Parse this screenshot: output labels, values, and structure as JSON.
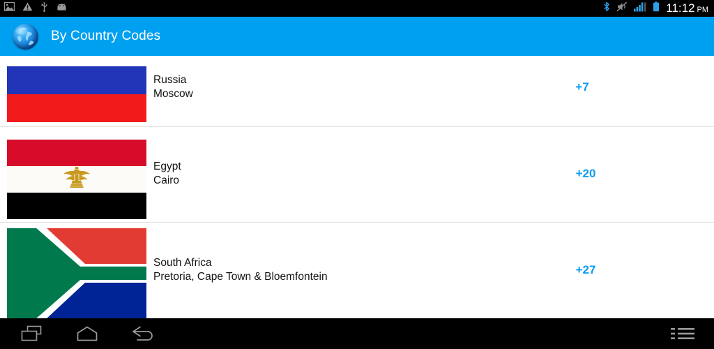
{
  "status_bar": {
    "left_icons": [
      {
        "name": "screenshot-icon",
        "label": "Screenshot"
      },
      {
        "name": "warning-icon",
        "label": "Warning"
      },
      {
        "name": "usb-icon",
        "label": "USB connected"
      },
      {
        "name": "android-icon",
        "label": "Android system"
      }
    ],
    "right_icons": [
      {
        "name": "bluetooth-icon",
        "label": "Bluetooth"
      },
      {
        "name": "mute-icon",
        "label": "Silent mode"
      },
      {
        "name": "signal-icon",
        "label": "Signal strength"
      },
      {
        "name": "battery-icon",
        "label": "Battery"
      }
    ],
    "time": "11:12",
    "am_pm": "PM"
  },
  "action_bar": {
    "icon": "globe-icon",
    "title": "By Country Codes",
    "background_color": "#00A0F0"
  },
  "list": {
    "code_color": "#0D9BF2",
    "rows": [
      {
        "country": "Russia",
        "capital": "Moscow",
        "code": "+7",
        "flag": "russia-flag"
      },
      {
        "country": "Egypt",
        "capital": "Cairo",
        "code": "+20",
        "flag": "egypt-flag"
      },
      {
        "country": "South Africa",
        "capital": "Pretoria, Cape Town & Bloemfontein",
        "code": "+27",
        "flag": "south-africa-flag"
      }
    ]
  },
  "nav_bar": {
    "buttons": [
      {
        "name": "recent-apps-icon",
        "label": "Recent apps"
      },
      {
        "name": "home-icon",
        "label": "Home"
      },
      {
        "name": "back-icon",
        "label": "Back"
      },
      {
        "name": "menu-list-icon",
        "label": "Menu"
      }
    ]
  }
}
